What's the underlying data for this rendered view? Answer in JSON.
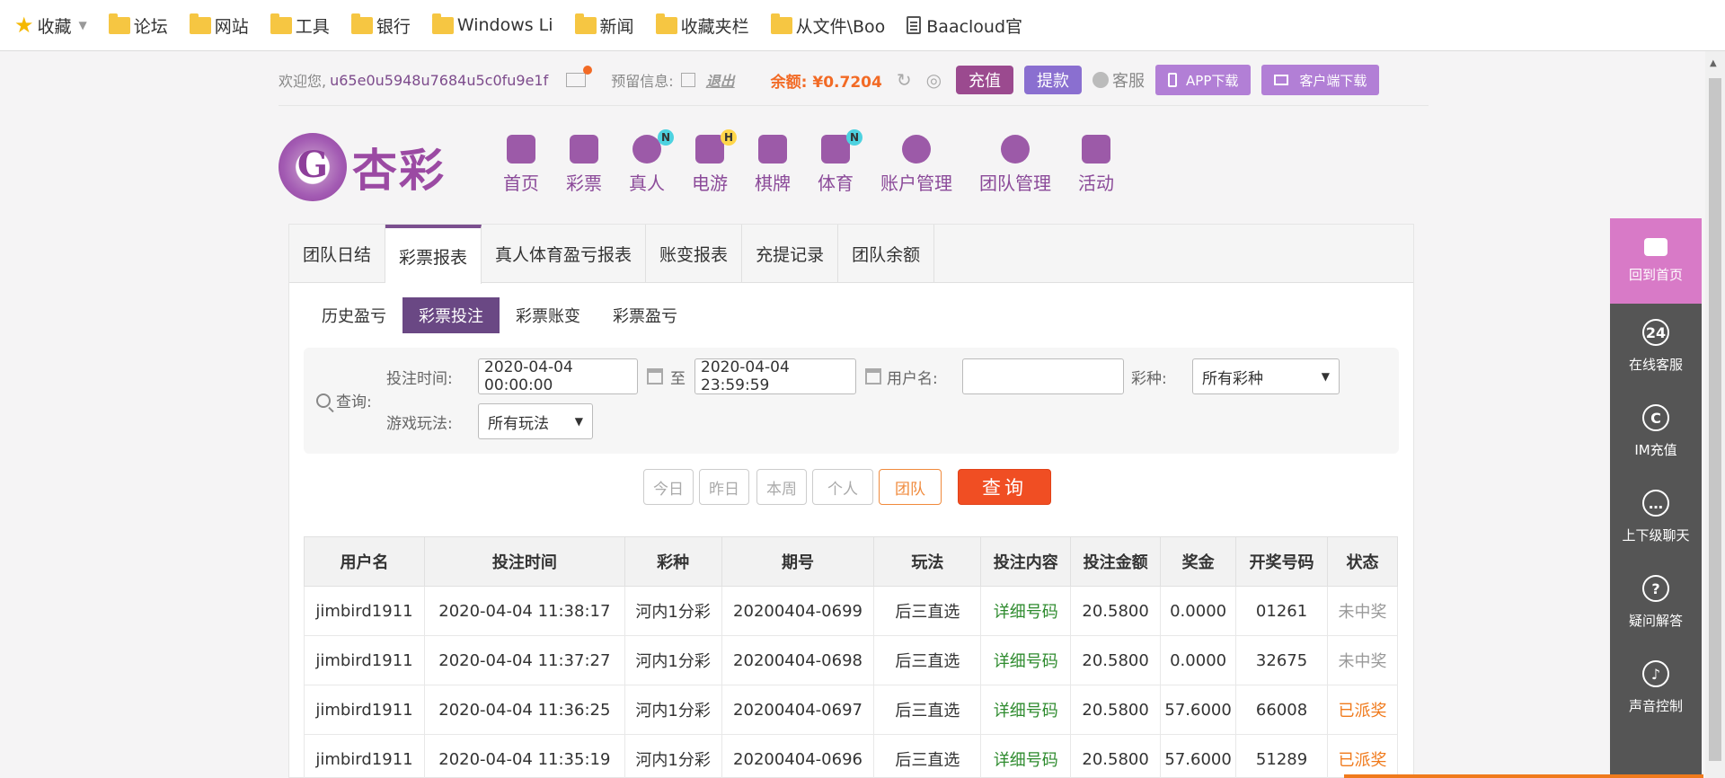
{
  "bookmarks": {
    "favorites": "收藏",
    "items": [
      "论坛",
      "网站",
      "工具",
      "银行",
      "Windows Li",
      "新闻",
      "收藏夹栏",
      "从文件\\Boo"
    ],
    "last": "Baacloud官"
  },
  "userbar": {
    "welcome": "欢迎您,",
    "username": "u65e0u5948u7684u5c0fu9e1f",
    "reserve_label": "预留信息:",
    "logout": "退出",
    "balance": "余额: ¥0.7204",
    "recharge": "充值",
    "withdraw": "提款",
    "service": "客服",
    "app_download": "APP下载",
    "client_download": "客户端下载"
  },
  "logo": {
    "text": "杏彩"
  },
  "nav": [
    {
      "label": "首页",
      "badge": ""
    },
    {
      "label": "彩票",
      "badge": ""
    },
    {
      "label": "真人",
      "badge": "N"
    },
    {
      "label": "电游",
      "badge": "H"
    },
    {
      "label": "棋牌",
      "badge": ""
    },
    {
      "label": "体育",
      "badge": "N"
    },
    {
      "label": "账户管理",
      "badge": ""
    },
    {
      "label": "团队管理",
      "badge": ""
    },
    {
      "label": "活动",
      "badge": ""
    }
  ],
  "tabs": [
    "团队日结",
    "彩票报表",
    "真人体育盈亏报表",
    "账变报表",
    "充提记录",
    "团队余额"
  ],
  "subtabs": [
    "历史盈亏",
    "彩票投注",
    "彩票账变",
    "彩票盈亏"
  ],
  "query": {
    "label": "查询:",
    "bet_time_label": "投注时间:",
    "start": "2020-04-04 00:00:00",
    "to": "至",
    "end": "2020-04-04 23:59:59",
    "username_label": "用户名:",
    "username_value": "",
    "lottery_label": "彩种:",
    "lottery_value": "所有彩种",
    "play_label": "游戏玩法:",
    "play_value": "所有玩法"
  },
  "buttons": {
    "today": "今日",
    "yesterday": "昨日",
    "week": "本周",
    "personal": "个人",
    "team": "团队",
    "search": "查询"
  },
  "table": {
    "headers": [
      "用户名",
      "投注时间",
      "彩种",
      "期号",
      "玩法",
      "投注内容",
      "投注金额",
      "奖金",
      "开奖号码",
      "状态"
    ],
    "rows": [
      [
        "jimbird1911",
        "2020-04-04 11:38:17",
        "河内1分彩",
        "20200404-0699",
        "后三直选",
        "详细号码",
        "20.5800",
        "0.0000",
        "01261",
        "未中奖"
      ],
      [
        "jimbird1911",
        "2020-04-04 11:37:27",
        "河内1分彩",
        "20200404-0698",
        "后三直选",
        "详细号码",
        "20.5800",
        "0.0000",
        "32675",
        "未中奖"
      ],
      [
        "jimbird1911",
        "2020-04-04 11:36:25",
        "河内1分彩",
        "20200404-0697",
        "后三直选",
        "详细号码",
        "20.5800",
        "57.6000",
        "66008",
        "已派奖"
      ],
      [
        "jimbird1911",
        "2020-04-04 11:35:19",
        "河内1分彩",
        "20200404-0696",
        "后三直选",
        "详细号码",
        "20.5800",
        "57.6000",
        "51289",
        "已派奖"
      ]
    ]
  },
  "sidebar": [
    "回到首页",
    "在线客服",
    "IM充值",
    "上下级聊天",
    "疑问解答",
    "声音控制"
  ],
  "colors": {
    "brand_purple": "#7b4f8f",
    "search_orange": "#f04e23",
    "balance_orange": "#f26a25"
  }
}
